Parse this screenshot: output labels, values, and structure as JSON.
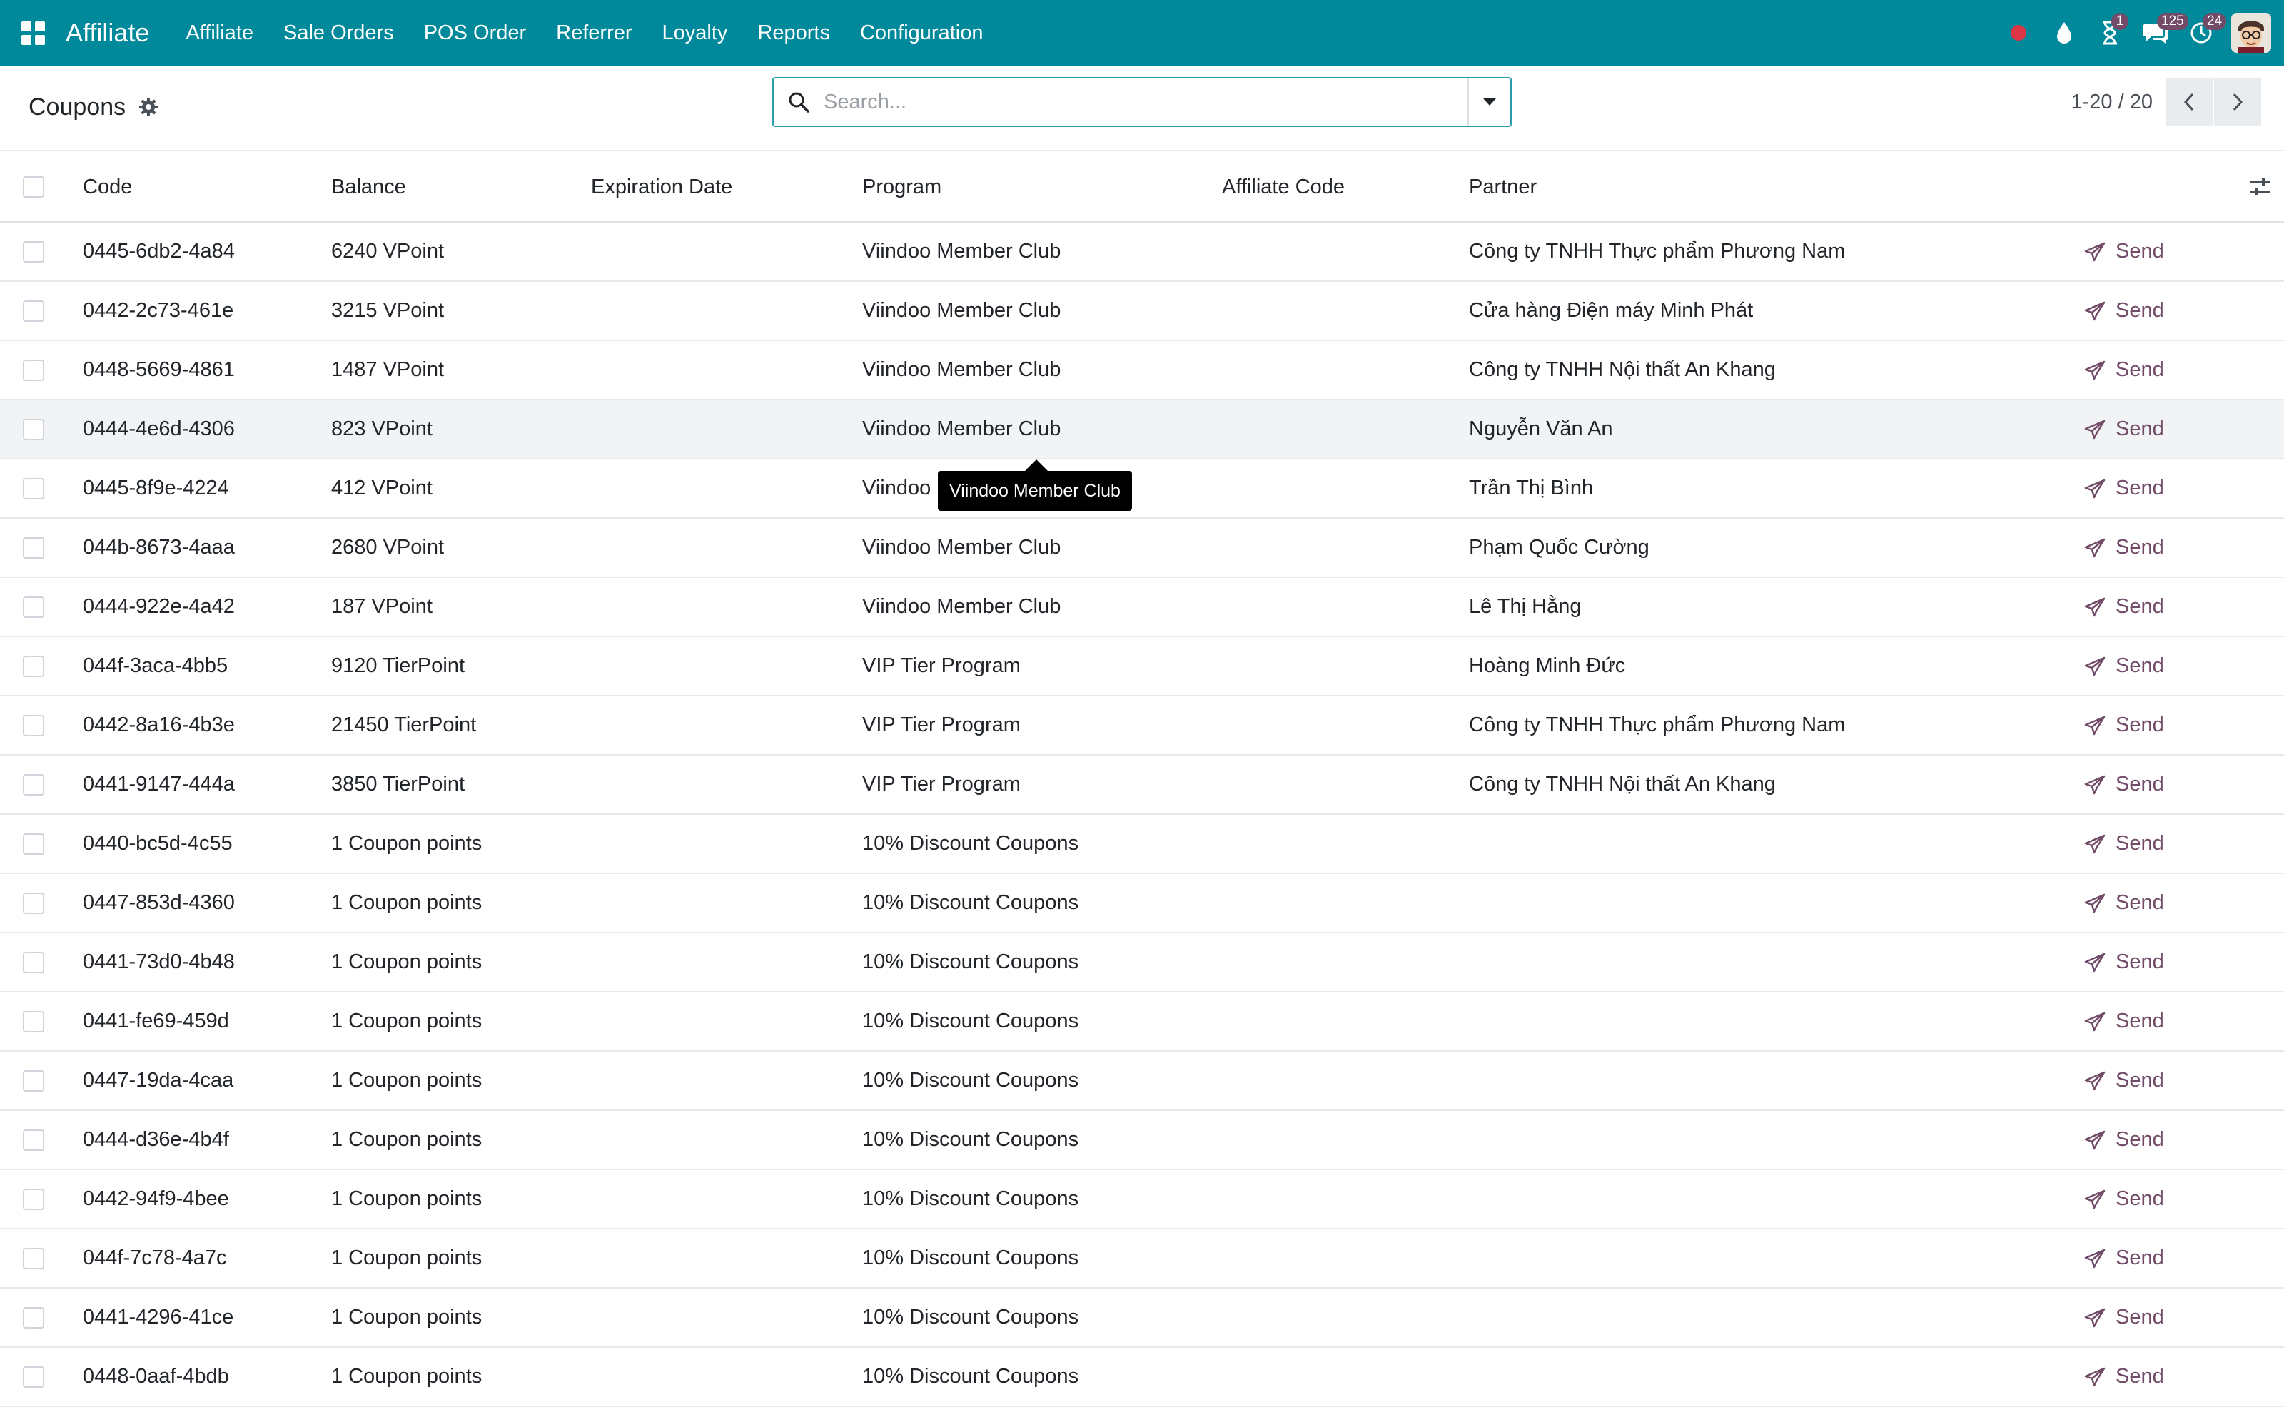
{
  "navbar": {
    "brand": "Affiliate",
    "menu": [
      "Affiliate",
      "Sale Orders",
      "POS Order",
      "Referrer",
      "Loyalty",
      "Reports",
      "Configuration"
    ],
    "badges": {
      "activity": "1",
      "messages": "125",
      "calls": "24"
    },
    "colors": {
      "bar": "#00899a",
      "badge": "#714b67",
      "record": "#dc3545"
    }
  },
  "control": {
    "title": "Coupons",
    "search_placeholder": "Search...",
    "search_value": "",
    "pager": "1-20 / 20"
  },
  "table": {
    "columns": {
      "code": "Code",
      "balance": "Balance",
      "expiration": "Expiration Date",
      "program": "Program",
      "affiliate_code": "Affiliate Code",
      "partner": "Partner"
    },
    "send_label": "Send",
    "rows": [
      {
        "code": "0445-6db2-4a84",
        "balance": "6240 VPoint",
        "expiration": "",
        "program": "Viindoo Member Club",
        "affiliate_code": "",
        "partner": "Công ty TNHH Thực phẩm Phương Nam"
      },
      {
        "code": "0442-2c73-461e",
        "balance": "3215 VPoint",
        "expiration": "",
        "program": "Viindoo Member Club",
        "affiliate_code": "",
        "partner": "Cửa hàng Điện máy Minh Phát"
      },
      {
        "code": "0448-5669-4861",
        "balance": "1487 VPoint",
        "expiration": "",
        "program": "Viindoo Member Club",
        "affiliate_code": "",
        "partner": "Công ty TNHH Nội thất An Khang"
      },
      {
        "code": "0444-4e6d-4306",
        "balance": "823 VPoint",
        "expiration": "",
        "program": "Viindoo Member Club",
        "affiliate_code": "",
        "partner": "Nguyễn Văn An"
      },
      {
        "code": "0445-8f9e-4224",
        "balance": "412 VPoint",
        "expiration": "",
        "program": "Viindoo Member Club",
        "affiliate_code": "",
        "partner": "Trần Thị Bình"
      },
      {
        "code": "044b-8673-4aaa",
        "balance": "2680 VPoint",
        "expiration": "",
        "program": "Viindoo Member Club",
        "affiliate_code": "",
        "partner": "Phạm Quốc Cường"
      },
      {
        "code": "0444-922e-4a42",
        "balance": "187 VPoint",
        "expiration": "",
        "program": "Viindoo Member Club",
        "affiliate_code": "",
        "partner": "Lê Thị Hằng"
      },
      {
        "code": "044f-3aca-4bb5",
        "balance": "9120 TierPoint",
        "expiration": "",
        "program": "VIP Tier Program",
        "affiliate_code": "",
        "partner": "Hoàng Minh Đức"
      },
      {
        "code": "0442-8a16-4b3e",
        "balance": "21450 TierPoint",
        "expiration": "",
        "program": "VIP Tier Program",
        "affiliate_code": "",
        "partner": "Công ty TNHH Thực phẩm Phương Nam"
      },
      {
        "code": "0441-9147-444a",
        "balance": "3850 TierPoint",
        "expiration": "",
        "program": "VIP Tier Program",
        "affiliate_code": "",
        "partner": "Công ty TNHH Nội thất An Khang"
      },
      {
        "code": "0440-bc5d-4c55",
        "balance": "1 Coupon points",
        "expiration": "",
        "program": "10% Discount Coupons",
        "affiliate_code": "",
        "partner": ""
      },
      {
        "code": "0447-853d-4360",
        "balance": "1 Coupon points",
        "expiration": "",
        "program": "10% Discount Coupons",
        "affiliate_code": "",
        "partner": ""
      },
      {
        "code": "0441-73d0-4b48",
        "balance": "1 Coupon points",
        "expiration": "",
        "program": "10% Discount Coupons",
        "affiliate_code": "",
        "partner": ""
      },
      {
        "code": "0441-fe69-459d",
        "balance": "1 Coupon points",
        "expiration": "",
        "program": "10% Discount Coupons",
        "affiliate_code": "",
        "partner": ""
      },
      {
        "code": "0447-19da-4caa",
        "balance": "1 Coupon points",
        "expiration": "",
        "program": "10% Discount Coupons",
        "affiliate_code": "",
        "partner": ""
      },
      {
        "code": "0444-d36e-4b4f",
        "balance": "1 Coupon points",
        "expiration": "",
        "program": "10% Discount Coupons",
        "affiliate_code": "",
        "partner": ""
      },
      {
        "code": "0442-94f9-4bee",
        "balance": "1 Coupon points",
        "expiration": "",
        "program": "10% Discount Coupons",
        "affiliate_code": "",
        "partner": ""
      },
      {
        "code": "044f-7c78-4a7c",
        "balance": "1 Coupon points",
        "expiration": "",
        "program": "10% Discount Coupons",
        "affiliate_code": "",
        "partner": ""
      },
      {
        "code": "0441-4296-41ce",
        "balance": "1 Coupon points",
        "expiration": "",
        "program": "10% Discount Coupons",
        "affiliate_code": "",
        "partner": ""
      },
      {
        "code": "0448-0aaf-4bdb",
        "balance": "1 Coupon points",
        "expiration": "",
        "program": "10% Discount Coupons",
        "affiliate_code": "",
        "partner": ""
      }
    ]
  },
  "tooltip": {
    "text": "Viindoo Member Club"
  },
  "icons": {
    "apps": "apps-grid-icon",
    "record": "record-dot-icon",
    "drop": "drop-icon",
    "activity": "hourglass-icon",
    "messages": "chat-icon",
    "calls": "phone-icon",
    "settings": "gear-icon",
    "search": "search-icon",
    "toggle": "caret-down-icon",
    "prev": "chevron-left-icon",
    "next": "chevron-right-icon",
    "column_settings": "sliders-icon",
    "send": "paper-plane-icon"
  }
}
